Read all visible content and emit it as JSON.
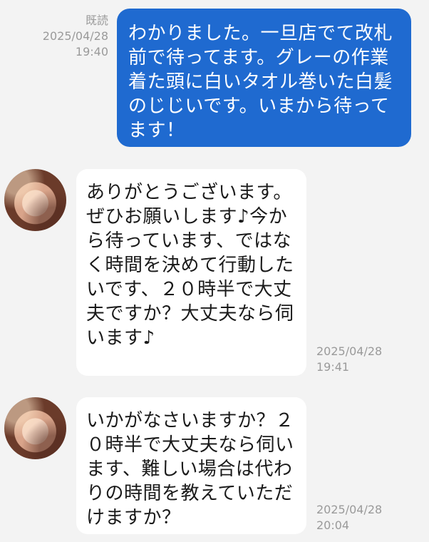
{
  "messages": [
    {
      "direction": "sent",
      "read_label": "既読",
      "date": "2025/04/28",
      "time": "19:40",
      "text": "わかりました。一旦店でて改札前で待ってます。グレーの作業着た頭に白いタオル巻いた白髪のじじいです。いまから待ってます！"
    },
    {
      "direction": "received",
      "date": "2025/04/28",
      "time": "19:41",
      "text": "ありがとうございます。ぜひお願いします♪今から待っています、ではなく時間を決めて行動したいです、２０時半で大丈夫ですか？大丈夫なら伺います♪"
    },
    {
      "direction": "received",
      "date": "2025/04/28",
      "time": "20:04",
      "text": "いかがなさいますか？２０時半で大丈夫なら伺います、難しい場合は代わりの時間を教えていただけますか？"
    }
  ],
  "colors": {
    "background": "#f3f3f3",
    "sent_bubble": "#1f6ad0",
    "received_bubble": "#ffffff",
    "meta_text": "#9a9a9a"
  },
  "icons": {
    "avatar": "user-avatar-photo"
  }
}
